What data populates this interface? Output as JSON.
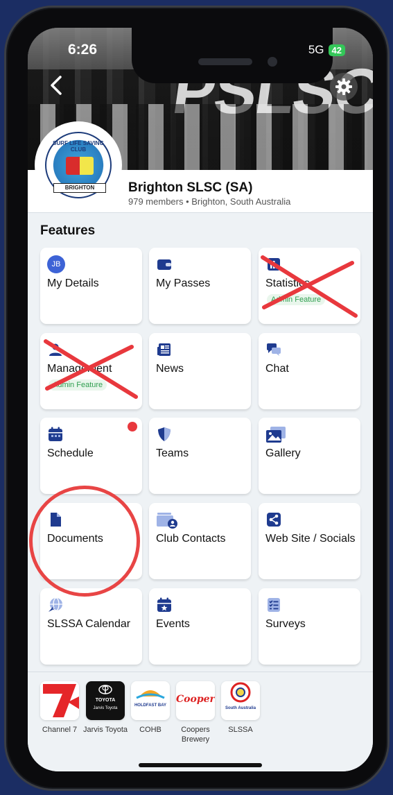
{
  "status": {
    "time": "6:26",
    "network": "5G",
    "battery": "42"
  },
  "club": {
    "name": "Brighton SLSC (SA)",
    "meta": "979 members • Brighton, South Australia",
    "logo_ring_text": "SURF LIFE SAVING CLUB",
    "logo_ribbon_text": "BRIGHTON"
  },
  "hero": {
    "letters": "PSLSC"
  },
  "features": {
    "title": "Features",
    "avatar_initials": "JB",
    "tiles": [
      {
        "label": "My Details",
        "icon": "avatar-icon"
      },
      {
        "label": "My Passes",
        "icon": "wallet-icon"
      },
      {
        "label": "Statistics",
        "icon": "chart-icon",
        "admin": "Admin Feature",
        "crossed_out": true
      },
      {
        "label": "Management",
        "icon": "person-icon",
        "admin": "Admin Feature",
        "crossed_out": true
      },
      {
        "label": "News",
        "icon": "newspaper-icon"
      },
      {
        "label": "Chat",
        "icon": "chat-icon"
      },
      {
        "label": "Schedule",
        "icon": "calendar-icon",
        "has_notification": true
      },
      {
        "label": "Teams",
        "icon": "shield-icon"
      },
      {
        "label": "Gallery",
        "icon": "gallery-icon"
      },
      {
        "label": "Documents",
        "icon": "document-icon",
        "circled": true
      },
      {
        "label": "Club Contacts",
        "icon": "contacts-icon"
      },
      {
        "label": "Web Site / Socials",
        "icon": "share-icon"
      },
      {
        "label": "SLSSA Calendar",
        "icon": "globe-icon"
      },
      {
        "label": "Events",
        "icon": "event-star-icon"
      },
      {
        "label": "Surveys",
        "icon": "survey-list-icon"
      }
    ]
  },
  "sponsors": [
    {
      "label": "Channel 7"
    },
    {
      "label": "Jarvis Toyota",
      "logo_text": "TOYOTA",
      "logo_sub": "Jarvis Toyota"
    },
    {
      "label": "COHB",
      "logo_text": "HOLDFAST BAY"
    },
    {
      "label": "Coopers Brewery",
      "logo_text": "Coopers"
    },
    {
      "label": "SLSSA",
      "logo_text": "South Australia"
    }
  ],
  "colors": {
    "accent": "#1f3b8f",
    "annotation_red": "#e8383d",
    "admin_green": "#2f9e4f"
  }
}
